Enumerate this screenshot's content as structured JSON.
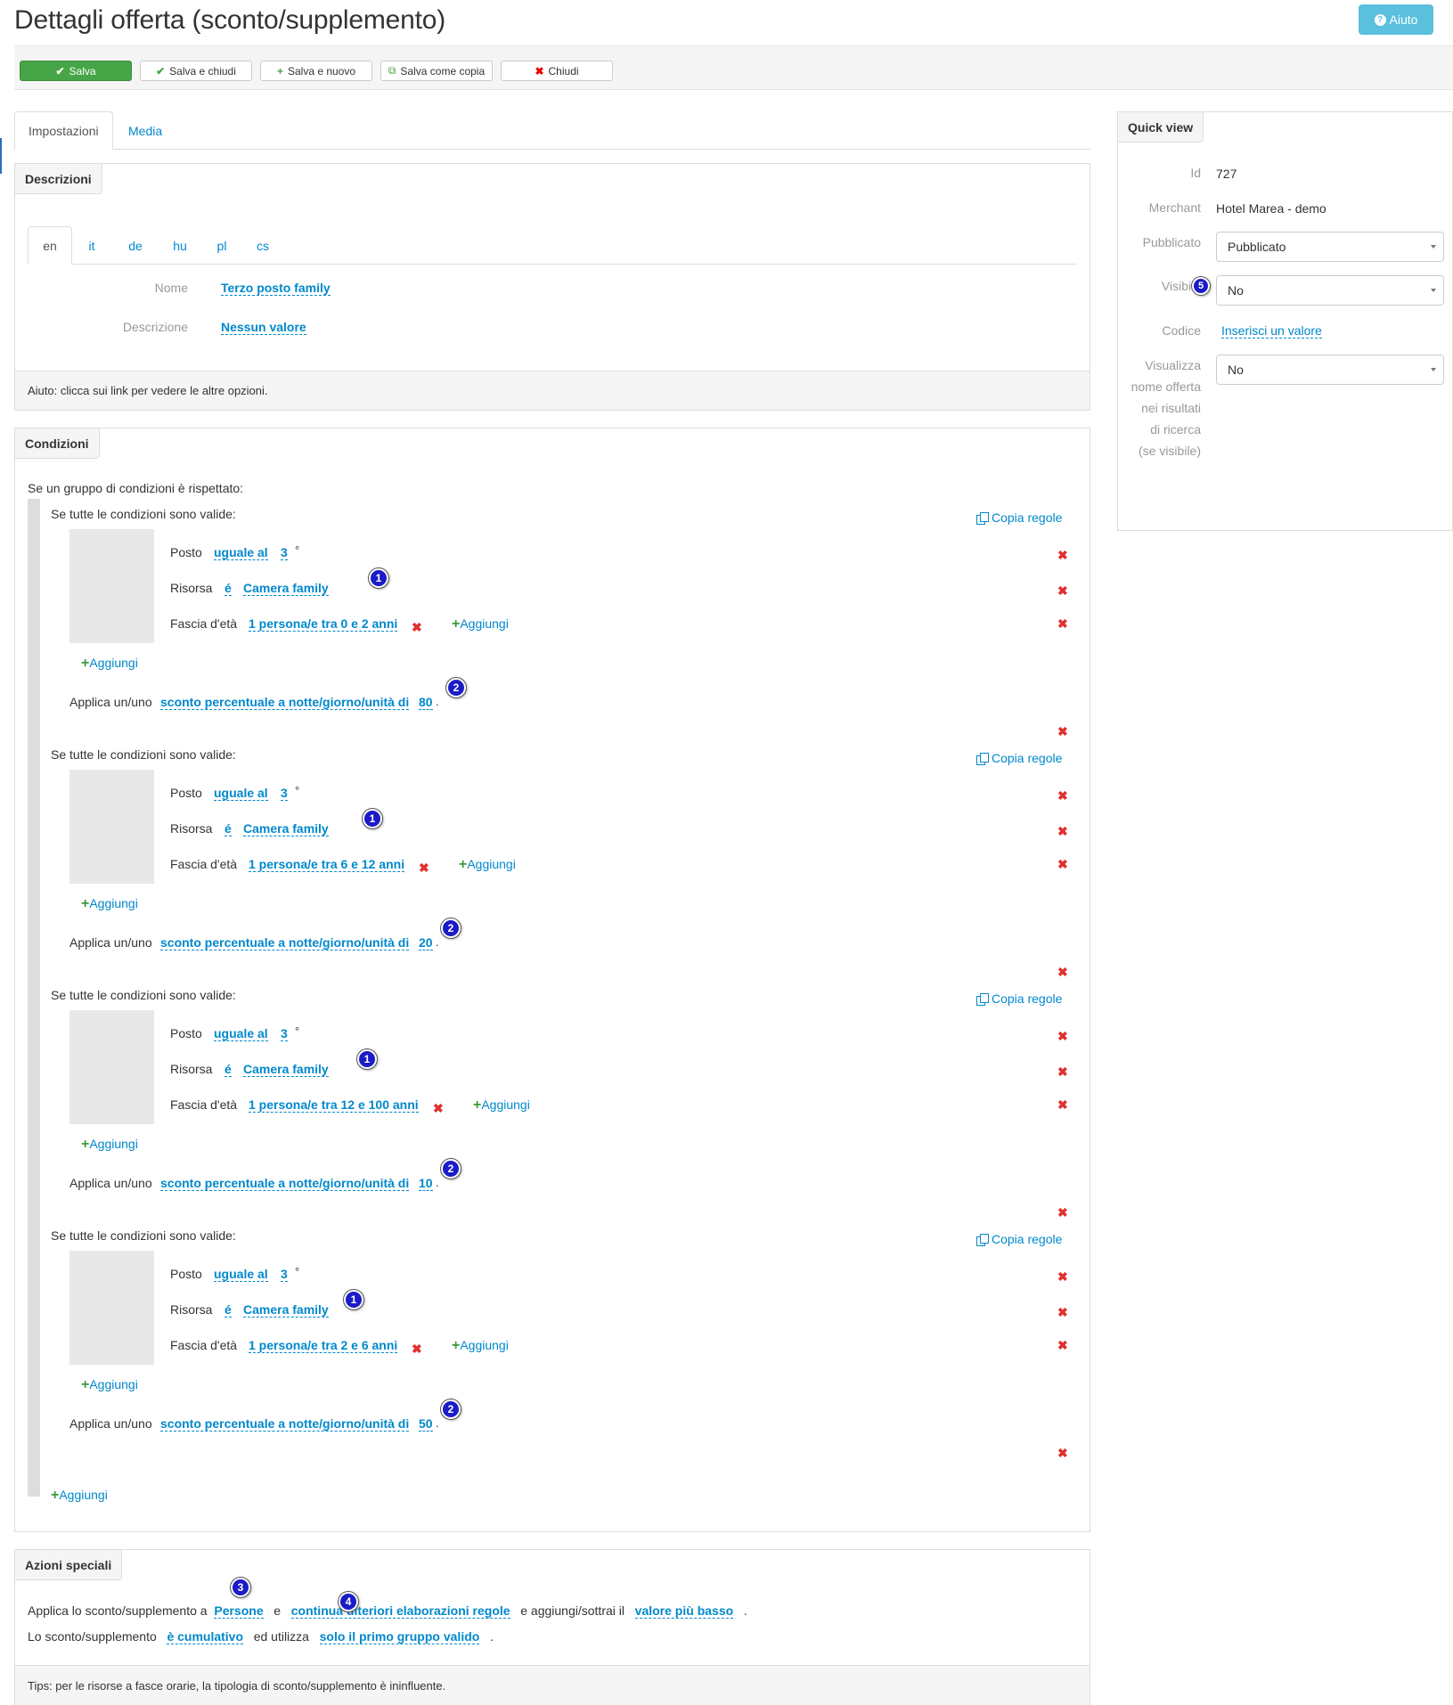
{
  "header": {
    "title": "Dettagli offerta (sconto/supplemento)",
    "help_label": "Aiuto",
    "help_icon": "question-icon"
  },
  "toolbar": {
    "save": "Salva",
    "save_close": "Salva e chiudi",
    "save_new": "Salva e nuovo",
    "save_copy": "Salva come copia",
    "close": "Chiudi"
  },
  "tabs": {
    "settings": "Impostazioni",
    "media": "Media"
  },
  "descriptions": {
    "title": "Descrizioni",
    "languages": [
      "en",
      "it",
      "de",
      "hu",
      "pl",
      "cs"
    ],
    "name_label": "Nome",
    "name_value": "Terzo posto family",
    "desc_label": "Descrizione",
    "desc_value": "Nessun valore",
    "footer": "Aiuto: clicca sui link per vedere le altre opzioni."
  },
  "conditions": {
    "title": "Condizioni",
    "intro": "Se un gruppo di condizioni è rispettato:",
    "group_head": "Se tutte le condizioni sono valide:",
    "copy_rules": "Copia regole",
    "posto_label": "Posto",
    "posto_op": "uguale al",
    "posto_value": "3",
    "posto_suffix": "°",
    "risorsa_label": "Risorsa",
    "risorsa_op": "é",
    "risorsa_value": "Camera family",
    "fascia_label": "Fascia d'età",
    "add": "Aggiungi",
    "apply_label": "Applica un/uno",
    "apply_link": "sconto percentuale a notte/giorno/unità di",
    "groups": [
      {
        "age": "1 persona/e tra 0 e 2 anni",
        "discount": "80"
      },
      {
        "age": "1 persona/e tra 6 e 12 anni",
        "discount": "20"
      },
      {
        "age": "1 persona/e tra 12 e 100 anni",
        "discount": "10"
      },
      {
        "age": "1 persona/e tra 2 e 6 anni",
        "discount": "50"
      }
    ],
    "badges": [
      "1",
      "2",
      "3",
      "4",
      "5"
    ]
  },
  "special": {
    "title": "Azioni speciali",
    "line1_a": "Applica lo sconto/supplemento a",
    "line1_link1": "Persone",
    "line1_b": "e",
    "line1_link2": "continua ulteriori elaborazioni regole",
    "line1_c": "e aggiungi/sottrai il",
    "line1_link3": "valore più basso",
    "dot": ".",
    "line2_a": "Lo sconto/supplemento",
    "line2_link1": "è cumulativo",
    "line2_b": "ed utilizza",
    "line2_link2": "solo il primo gruppo valido",
    "footer": "Tips: per le risorse a fasce orarie, la tipologia di sconto/supplemento è ininfluente."
  },
  "quickview": {
    "title": "Quick view",
    "id_label": "Id",
    "id_value": "727",
    "merchant_label": "Merchant",
    "merchant_value": "Hotel Marea - demo",
    "published_label": "Pubblicato",
    "published_value": "Pubblicato",
    "visible_label": "Visibile",
    "visible_value": "No",
    "code_label": "Codice",
    "code_value": "Inserisci un valore",
    "show_name_label": "Visualizza nome offerta nei risultati di ricerca (se visibile)",
    "show_name_value": "No"
  }
}
